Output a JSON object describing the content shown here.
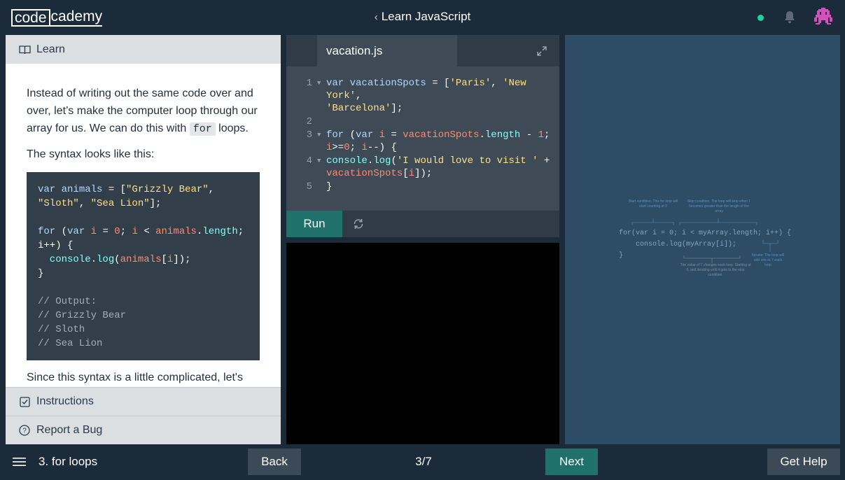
{
  "header": {
    "logo_box": "code",
    "logo_rest": "cademy",
    "course_title": "Learn JavaScript",
    "status_color": "#1dd4a0"
  },
  "left_panel": {
    "learn_tab": "Learn",
    "lesson": {
      "p1_before": "Instead of writing out the same code over and over, let’s make the computer loop through our array for us. We can do this with ",
      "p1_code": "for",
      "p1_after": " loops.",
      "p2": "The syntax looks like this:",
      "example": {
        "l1_a": "var ",
        "l1_b": "animals",
        "l1_c": " = [",
        "l1_d": "\"Grizzly Bear\"",
        "l1_e": ",",
        "l2_a": "\"Sloth\"",
        "l2_b": ", ",
        "l2_c": "\"Sea Lion\"",
        "l2_d": "];",
        "l4_a": "for",
        "l4_b": " (",
        "l4_c": "var ",
        "l4_d": "i",
        "l4_e": " = ",
        "l4_f": "0",
        "l4_g": "; ",
        "l4_h": "i",
        "l4_i": " < ",
        "l4_j": "animals",
        "l4_k": ".",
        "l4_l": "length",
        "l4_m": ";",
        "l5": "i++) {",
        "l6_a": "  console",
        "l6_b": ".",
        "l6_c": "log",
        "l6_d": "(",
        "l6_e": "animals",
        "l6_f": "[",
        "l6_g": "i",
        "l6_h": "]);",
        "l7": "}",
        "c1": "// Output:",
        "c2": "// Grizzly Bear",
        "c3": "// Sloth",
        "c4": "// Sea Lion"
      },
      "p3": "Since this syntax is a little complicated, let's"
    },
    "instructions_tab": "Instructions",
    "bug_tab": "Report a Bug"
  },
  "editor": {
    "file_name": "vacation.js",
    "lines": {
      "n1": "1",
      "n2": "2",
      "n3": "3",
      "n4": "4",
      "n5": "5"
    },
    "code": {
      "l1_a": "var ",
      "l1_b": "vacationSpots",
      "l1_c": " = [",
      "l1_d": "'Paris'",
      "l1_e": ", ",
      "l1_f": "'New York'",
      "l1_g": ",",
      "l1w_a": "'Barcelona'",
      "l1w_b": "];",
      "l3_a": "for",
      "l3_b": " (",
      "l3_c": "var ",
      "l3_d": "i",
      "l3_e": " = ",
      "l3_f": "vacationSpots",
      "l3_g": ".",
      "l3_h": "length",
      "l3_i": " - ",
      "l3_j": "1",
      "l3_k": ";",
      "l3w_a": "i",
      "l3w_b": ">=",
      "l3w_c": "0",
      "l3w_d": "; ",
      "l3w_e": "i",
      "l3w_f": "--) {",
      "l4_a": "  console",
      "l4_b": ".",
      "l4_c": "log",
      "l4_d": "(",
      "l4_e": "'I would love to visit '",
      "l4_f": " +",
      "l4w_a": "vacationSpots",
      "l4w_b": "[",
      "l4w_c": "i",
      "l4w_d": "]);",
      "l5": "}"
    },
    "run_label": "Run"
  },
  "diagram": {
    "start_condition": "Start condition. This for loop will start counting at 0",
    "stop_condition": "Stop condition. The loop will stop when 'i' becomes greater than the length of the array",
    "code_l1": "for(var i = 0; i < myArray.length; i++) {",
    "code_l2": "    console.log(myArray[i]);",
    "code_l3": "}",
    "value_note": "The value of 'i' changes each loop. Starting at 0, and iterating until it gets to the stop condition.",
    "iterator_note": "Iterator. The loop will add one to 'i' each loop"
  },
  "footer": {
    "lesson_name": "3. for loops",
    "back_label": "Back",
    "progress": "3/7",
    "next_label": "Next",
    "help_label": "Get Help"
  }
}
